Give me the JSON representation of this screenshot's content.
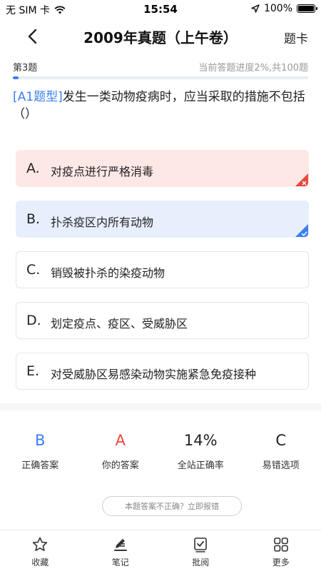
{
  "status": {
    "carrier": "无 SIM 卡",
    "time": "15:54",
    "battery": "100%"
  },
  "nav": {
    "title": "2009年真题（上午卷）",
    "right_label": "题卡"
  },
  "progress": {
    "question_number": "第3题",
    "text": "当前答题进度2%,共100题",
    "fraction": 0.02
  },
  "question": {
    "type_tag": "[A1题型]",
    "text": "发生一类动物疫病时，应当采取的措施不包括（）"
  },
  "options": [
    {
      "letter": "A.",
      "text": "对疫点进行严格消毒",
      "state": "wrong"
    },
    {
      "letter": "B.",
      "text": "扑杀疫区内所有动物",
      "state": "correct"
    },
    {
      "letter": "C.",
      "text": "销毁被扑杀的染疫动物",
      "state": "normal"
    },
    {
      "letter": "D.",
      "text": "划定疫点、疫区、受威胁区",
      "state": "normal"
    },
    {
      "letter": "E.",
      "text": "对受威胁区易感染动物实施紧急免疫接种",
      "state": "normal"
    }
  ],
  "stats": [
    {
      "value": "B",
      "label": "正确答案",
      "color": "#3a7ef0"
    },
    {
      "value": "A",
      "label": "你的答案",
      "color": "#e8483b"
    },
    {
      "value": "14%",
      "label": "全站正确率",
      "color": "#222222"
    },
    {
      "value": "C",
      "label": "易错选项",
      "color": "#222222"
    }
  ],
  "report_label": "本题答案不正确？立即报错",
  "tabs": [
    {
      "label": "收藏",
      "icon": "star-icon"
    },
    {
      "label": "笔记",
      "icon": "note-icon"
    },
    {
      "label": "批阅",
      "icon": "review-icon"
    },
    {
      "label": "更多",
      "icon": "grid-icon"
    }
  ],
  "colors": {
    "accent": "#3a7ef0",
    "wrong": "#e8483b",
    "wrong_bg": "#fde8e6",
    "correct_bg": "#e8effc"
  }
}
